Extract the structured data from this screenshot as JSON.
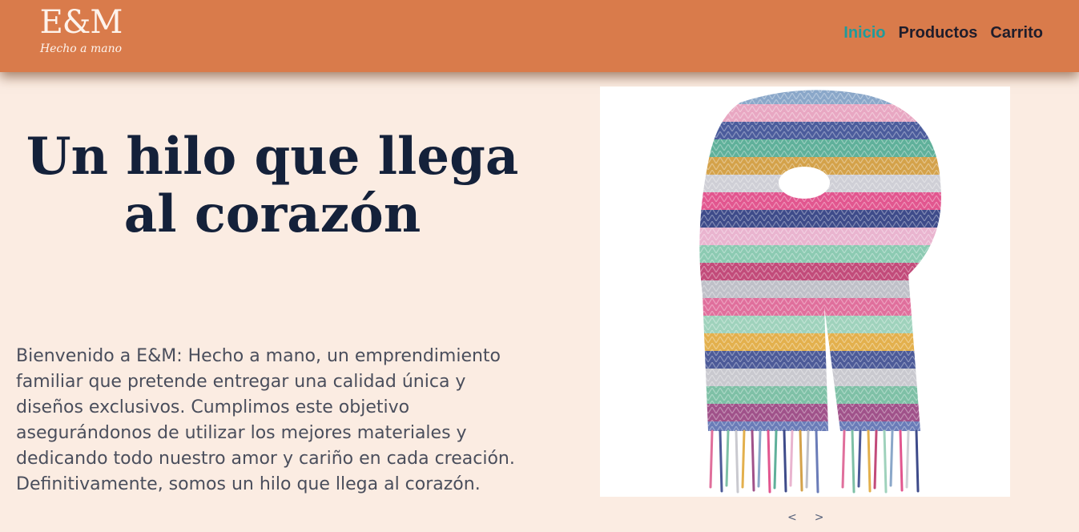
{
  "brand": {
    "name": "E&M",
    "tagline": "Hecho a mano"
  },
  "nav": {
    "items": [
      {
        "label": "Inicio",
        "active": true
      },
      {
        "label": "Productos",
        "active": false
      },
      {
        "label": "Carrito",
        "active": false
      }
    ]
  },
  "hero": {
    "title": "Un hilo que llega al corazón",
    "description": "Bienvenido a E&M: Hecho a mano, un emprendimiento familiar que pretende entregar una calidad única y diseños exclusivos. Cumplimos este objetivo asegurándonos de utilizar los mejores materiales y dedicando todo nuestro amor y cariño en cada creación. Definitivamente, somos un hilo que llega al corazón."
  },
  "carousel": {
    "prev_label": "<",
    "next_label": ">",
    "image_icon": "knitted-scarf-image"
  },
  "colors": {
    "header": "#d97b4b",
    "background": "#fbece2",
    "nav_active": "#1f9b9b",
    "nav_text": "#1f1d2b",
    "title": "#14213a",
    "body_text": "#4a4e5c"
  }
}
